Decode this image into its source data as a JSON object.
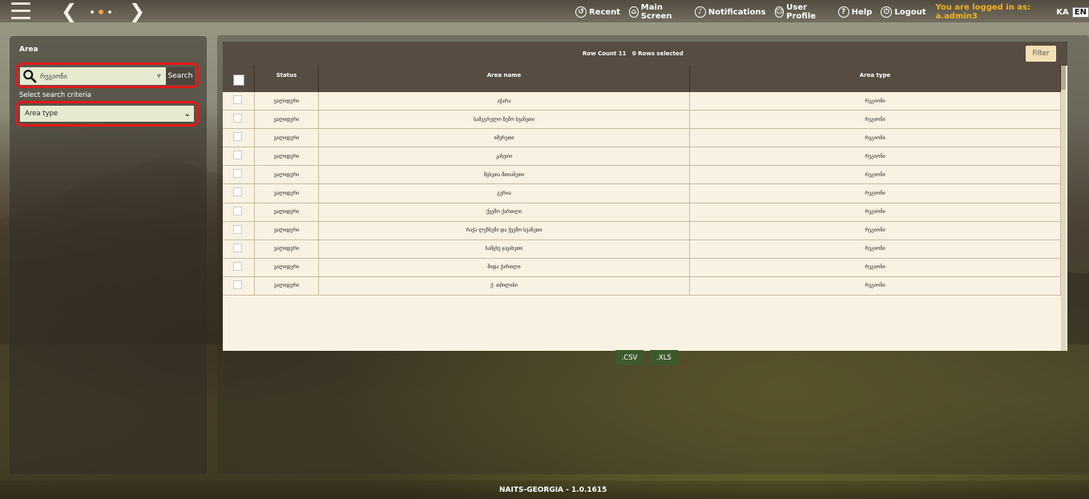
{
  "topbar": {
    "links": [
      {
        "label": "Recent",
        "icon": "recent-icon"
      },
      {
        "label": "Main Screen",
        "icon": "home-icon"
      },
      {
        "label": "Notifications",
        "icon": "bell-icon"
      },
      {
        "label": "User Profile",
        "icon": "user-icon"
      },
      {
        "label": "Help",
        "icon": "help-icon"
      },
      {
        "label": "Logout",
        "icon": "power-icon"
      }
    ],
    "logged_in": "You are logged in as: a.admin3",
    "lang_ka": "KA",
    "lang_en": "EN"
  },
  "left": {
    "title": "Area",
    "search_value": "რეგიონი",
    "search_button": "Search",
    "criteria_label": "Select search criteria",
    "criteria_value": "Area type"
  },
  "grid": {
    "row_count": "Row Count 11",
    "rows_selected": "0 Rows selected",
    "filter_button": "Filter",
    "columns": [
      "Status",
      "Area name",
      "Area type"
    ],
    "rows": [
      {
        "status": "ვალიდური",
        "name": "აჭარა",
        "type": "რეგიონი"
      },
      {
        "status": "ვალიდური",
        "name": "სამეგრელო ზემო სვანეთი",
        "type": "რეგიონი"
      },
      {
        "status": "ვალიდური",
        "name": "იმერეთი",
        "type": "რეგიონი"
      },
      {
        "status": "ვალიდური",
        "name": "კახეთი",
        "type": "რეგიონი"
      },
      {
        "status": "ვალიდური",
        "name": "მცხეთა მთიანეთი",
        "type": "რეგიონი"
      },
      {
        "status": "ვალიდური",
        "name": "გურია",
        "type": "რეგიონი"
      },
      {
        "status": "ვალიდური",
        "name": "ქვემო ქართლი",
        "type": "რეგიონი"
      },
      {
        "status": "ვალიდური",
        "name": "რაჭა ლეჩხუმი და ქვემო სვანეთი",
        "type": "რეგიონი"
      },
      {
        "status": "ვალიდური",
        "name": "სამცხე ჯავახეთი",
        "type": "რეგიონი"
      },
      {
        "status": "ვალიდური",
        "name": "შიდა ქართლი",
        "type": "რეგიონი"
      },
      {
        "status": "ვალიდური",
        "name": "ქ. თბილისი",
        "type": "რეგიონი"
      }
    ]
  },
  "export": {
    "csv": ".CSV",
    "xls": ".XLS"
  },
  "footer": "NAITS-GEORGIA - 1.0.1615",
  "colors": {
    "accent": "#f0a43a",
    "highlight": "#e11a1a",
    "export_green": "#3d5a2c"
  }
}
